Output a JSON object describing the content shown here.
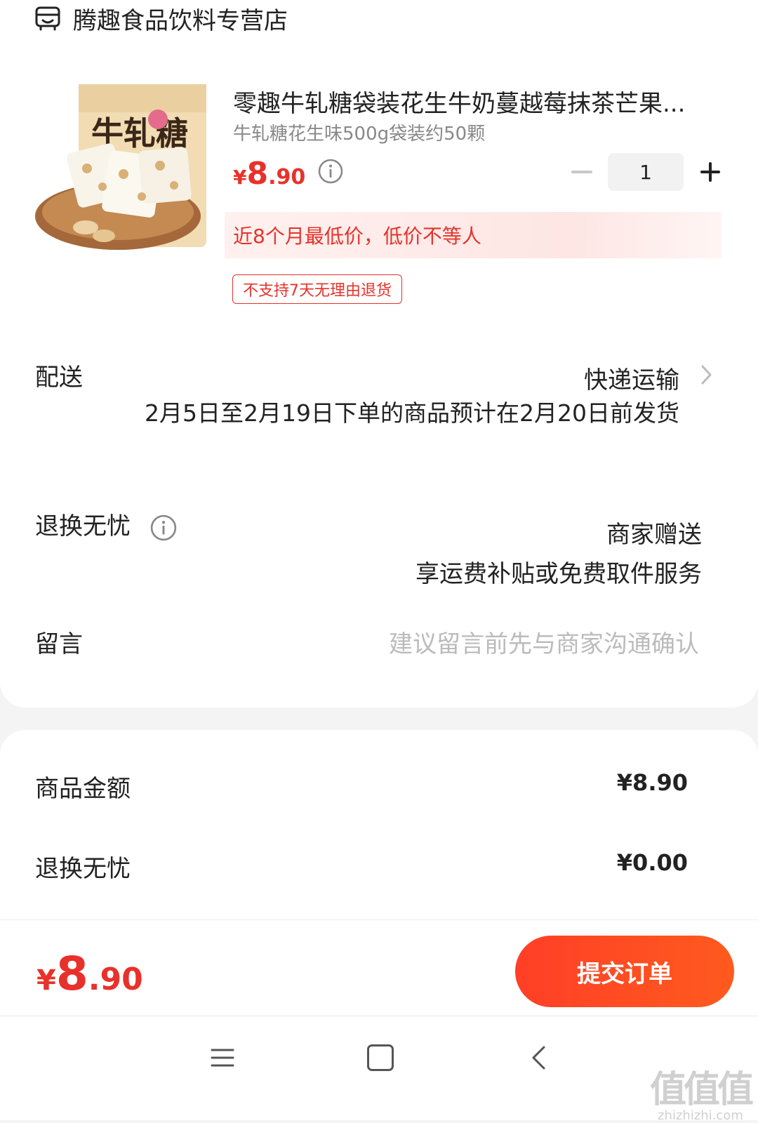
{
  "shop": {
    "name": "腾趣食品饮料专营店",
    "icon": "store-icon"
  },
  "product": {
    "title": "零趣牛轧糖袋装花生牛奶蔓越莓抹茶芒果...",
    "spec": "牛轧糖花生味500g袋装约50颗",
    "price_symbol": "¥",
    "price_int": "8",
    "price_dec": ".90",
    "quantity": "1",
    "promo": "近8个月最低价，低价不等人",
    "return_policy": "不支持7天无理由退货",
    "image_label": "牛轧糖"
  },
  "delivery": {
    "label": "配送",
    "method": "快递运输",
    "note": "2月5日至2月19日下单的商品预计在2月20日前发货"
  },
  "worry_free": {
    "label": "退换无忧",
    "gift": "商家赠送",
    "sub": "享运费补贴或免费取件服务"
  },
  "message": {
    "label": "留言",
    "placeholder": "建议留言前先与商家沟通确认"
  },
  "summary": {
    "goods_label": "商品金额",
    "goods_value": "¥8.90",
    "worry_label": "退换无忧",
    "worry_value": "¥0.00"
  },
  "footer": {
    "total_symbol": "¥",
    "total_int": "8",
    "total_dec": ".90",
    "submit_label": "提交订单"
  },
  "watermark": {
    "big": "值值值",
    "small": "zhizhizhi.com"
  },
  "colors": {
    "accent": "#e8312a",
    "button": "#ff4a22"
  }
}
